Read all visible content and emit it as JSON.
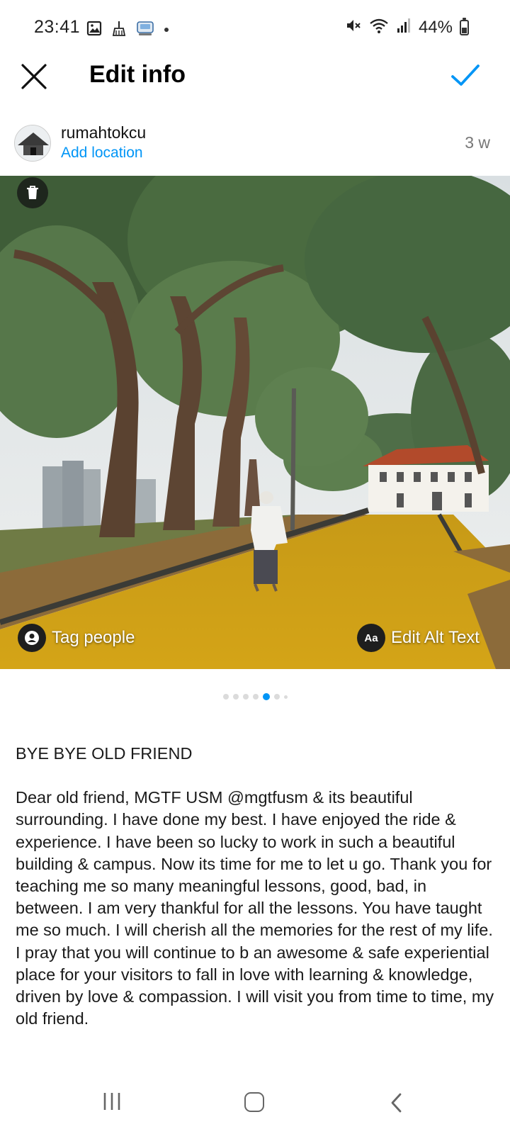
{
  "status_bar": {
    "time": "23:41",
    "battery": "44%",
    "battery_level": 0.44,
    "left_icons": [
      "gallery-icon",
      "cleaner-icon",
      "radio-icon",
      "dot-icon"
    ],
    "right_icons": [
      "mute-icon",
      "wifi-icon",
      "signal-icon",
      "battery-icon"
    ]
  },
  "header": {
    "title": "Edit info",
    "close_icon": "close-icon",
    "confirm_icon": "checkmark-icon",
    "accent_color": "#0095f6"
  },
  "post": {
    "username": "rumahtokcu",
    "location_link": "Add location",
    "age": "3 w"
  },
  "photo": {
    "tag_people": "Tag people",
    "edit_alt_text": "Edit Alt Text",
    "alt_icon_text": "Aa",
    "delete_icon": "trash-icon",
    "carousel": {
      "count": 7,
      "active_index": 4
    }
  },
  "caption": {
    "title": "BYE BYE OLD FRIEND",
    "body": "Dear old friend, MGTF USM @mgtfusm & its beautiful surrounding. I have done my best. I have enjoyed the ride & experience. I have been so lucky to work in such a beautiful building & campus. Now its time for me to let u go. Thank you for teaching me so many meaningful lessons, good, bad, in between. I am very thankful for all the lessons. You have taught me so much. I will cherish all the memories for the rest of my life. I pray that you will continue to b an awesome & safe experiential place for your visitors to fall in love with learning & knowledge, driven by love & compassion. I will visit you from time to time, my old friend."
  },
  "nav_bar": {
    "icons": [
      "recents-icon",
      "home-icon",
      "back-icon"
    ]
  }
}
